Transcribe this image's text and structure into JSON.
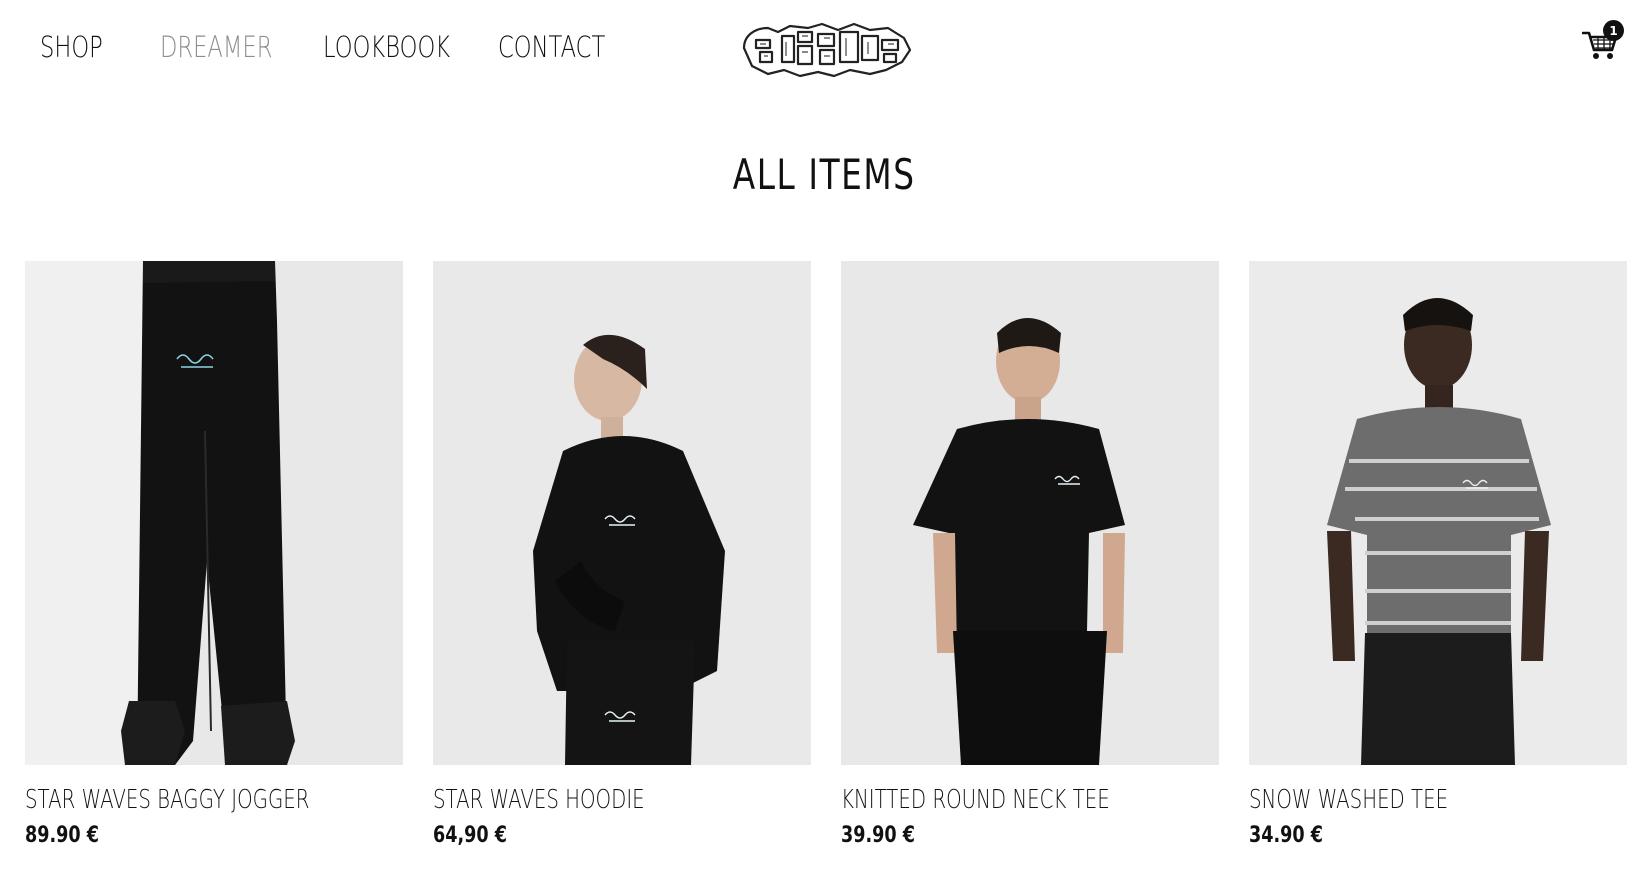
{
  "header": {
    "nav": [
      {
        "label": "SHOP",
        "active": false
      },
      {
        "label": "DREAMER",
        "active": true
      },
      {
        "label": "LOOKBOOK",
        "active": false
      },
      {
        "label": "CONTACT",
        "active": false
      }
    ],
    "logo_text": "dreamer",
    "cart": {
      "icon": "cart-icon",
      "count": "1"
    }
  },
  "main": {
    "title": "ALL ITEMS",
    "products": [
      {
        "name": "STAR WAVES BAGGY JOGGER",
        "price": "89.90 €"
      },
      {
        "name": "STAR WAVES HOODIE",
        "price": "64,90 €"
      },
      {
        "name": "KNITTED ROUND NECK TEE",
        "price": "39.90 €"
      },
      {
        "name": "SNOW WASHED TEE",
        "price": "34.90 €"
      }
    ]
  },
  "colors": {
    "text": "#111111",
    "active_nav": "#8e8e8e",
    "photo_bg": "#e7e7e7",
    "garment_black": "#121212",
    "print_accent": "#8fd3e6",
    "stripe_grey": "#6d6d6d"
  }
}
